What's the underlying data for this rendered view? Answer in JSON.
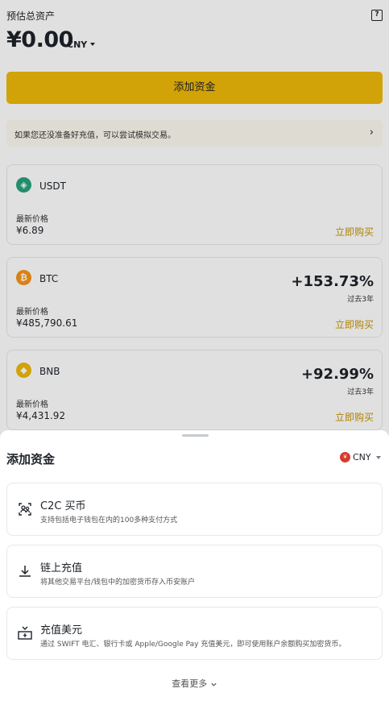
{
  "header": {
    "label": "预估总资产",
    "balance": "¥0.00",
    "currency": "CNY",
    "help_icon": "help-book-icon"
  },
  "add_funds_button": "添加资金",
  "notice": {
    "text": "如果您还没准备好充值，可以尝试模拟交易。",
    "chevron": "›"
  },
  "assets": [
    {
      "symbol": "USDT",
      "icon_glyph": "◈",
      "icon_color": "#26a17b",
      "price_label": "最新价格",
      "price": "¥6.89",
      "buy_label": "立即购买",
      "change": "",
      "period": ""
    },
    {
      "symbol": "BTC",
      "icon_glyph": "₿",
      "icon_color": "#f7931a",
      "price_label": "最新价格",
      "price": "¥485,790.61",
      "buy_label": "立即购买",
      "change": "+153.73%",
      "period": "过去3年"
    },
    {
      "symbol": "BNB",
      "icon_glyph": "◆",
      "icon_color": "#f0b90b",
      "price_label": "最新价格",
      "price": "¥4,431.92",
      "buy_label": "立即购买",
      "change": "+92.99%",
      "period": "过去3年"
    }
  ],
  "sheet": {
    "title": "添加资金",
    "currency": "CNY",
    "flag_glyph": "¥",
    "options": [
      {
        "title": "C2C 买币",
        "desc": "支持包括电子钱包在内的100多种支付方式",
        "icon": "c2c-users-icon"
      },
      {
        "title": "链上充值",
        "desc": "将其他交易平台/钱包中的加密货币存入币安账户",
        "icon": "download-icon"
      },
      {
        "title": "充值美元",
        "desc": "通过 SWIFT 电汇、银行卡或 Apple/Google Pay 充值美元，即可使用账户余额购买加密货币。",
        "icon": "deposit-usd-icon"
      }
    ],
    "see_more": "查看更多"
  },
  "colors": {
    "accent": "#f0b90b",
    "buy_link": "#c99400"
  }
}
